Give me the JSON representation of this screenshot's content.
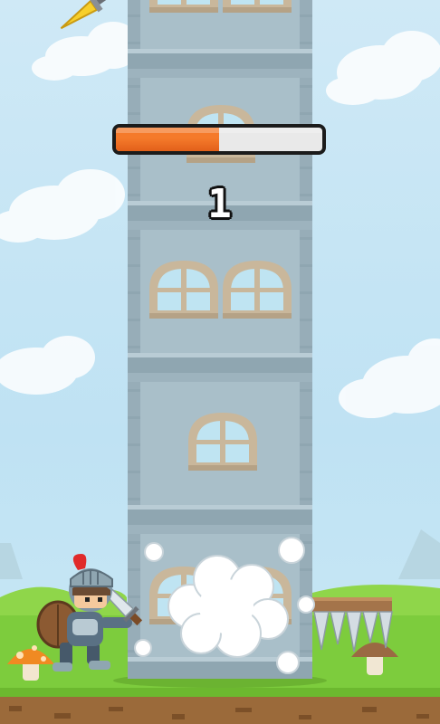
{
  "game": {
    "score": "1",
    "timer_fraction": 0.5
  },
  "colors": {
    "sky": "#c6e6f4",
    "tower_stone": "#a9bfc9",
    "tower_dark": "#8fa6b1",
    "window_frame": "#c9b79b",
    "window_glass": "#bfe4f2",
    "grass": "#7dcc3d",
    "dirt": "#9b6a3a",
    "timer_fill": "#f57a2b"
  },
  "sprites": {
    "knight": "knight-with-sword-and-shield",
    "left_mushroom": "orange-spotted-mushroom",
    "right_mushroom": "brown-mushroom",
    "spike_platform": "wooden-platform-with-spikes",
    "falling_sword": "golden-sword",
    "dust_cloud": "smoke-puff"
  }
}
